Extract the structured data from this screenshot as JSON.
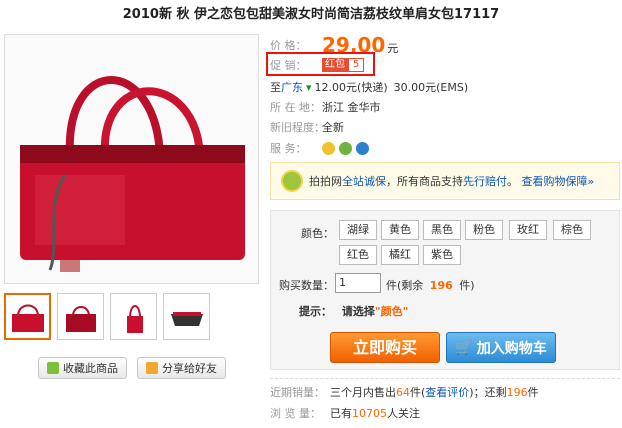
{
  "title": "2010新 秋 伊之恋包包甜美淑女时尚简洁荔枝纹单肩女包17117",
  "price": {
    "label": "价    格：",
    "value": "29.00",
    "unit": "元"
  },
  "promo": {
    "label": "促    销：",
    "tag": "红包",
    "num": "5"
  },
  "shipping": {
    "prefix": "至",
    "dest": "广东",
    "fast": "12.00元(快递)",
    "ems": "30.00元(EMS)"
  },
  "location": {
    "label": "所 在 地：",
    "value": "浙江 金华市"
  },
  "condition": {
    "label": "新旧程度：",
    "value": "全新"
  },
  "service": {
    "label": "服    务："
  },
  "guarantee": {
    "a": "拍拍网",
    "b": "全站诚保",
    "c": "，所有商品支持",
    "d": "先行赔付",
    "e": "。",
    "f": "查看购物保障»"
  },
  "colors": {
    "label": "颜色：",
    "options": [
      "湖绿",
      "黄色",
      "黑色",
      "粉色",
      "玫红",
      "棕色",
      "红色",
      "橘红",
      "紫色"
    ]
  },
  "quantity": {
    "label": "购买数量：",
    "value": "1",
    "stock_a": "件(剩余",
    "stock_num": "196",
    "stock_b": "件)"
  },
  "hint": {
    "label": "提示：",
    "text": "请选择",
    "color": "\"颜色\""
  },
  "buttons": {
    "buy_now": "立即购买",
    "add_cart": "加入购物车",
    "favorite": "收藏此商品",
    "share": "分享给好友"
  },
  "sales": {
    "label": "近期销量：",
    "a": "三个月内售出",
    "num": "64",
    "b": "件(",
    "link": "查看评价",
    "c": ")；还剩",
    "left": "196",
    "d": "件"
  },
  "views": {
    "label": "浏 览 量：",
    "a": "已有",
    "num": "10705",
    "b": "人关注"
  },
  "colors_theme": {
    "accent": "#f60",
    "link": "#0a56b7",
    "promo_border": "#e11"
  }
}
